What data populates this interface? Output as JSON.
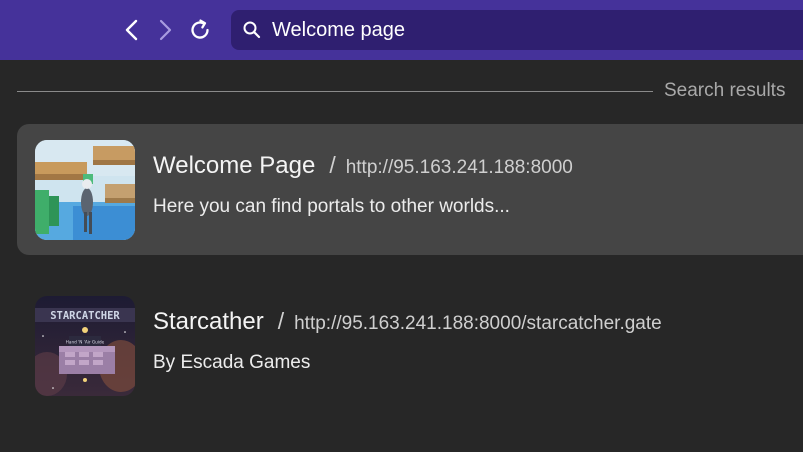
{
  "toolbar": {
    "back_icon": "chevron-left-icon",
    "forward_icon": "chevron-right-icon",
    "reload_icon": "reload-icon"
  },
  "search": {
    "icon": "search-icon",
    "value": "Welcome page"
  },
  "section": {
    "label": "Search results"
  },
  "results": [
    {
      "title": "Welcome Page",
      "separator": "/",
      "url": "http://95.163.241.188:8000",
      "description": "Here you can find portals to other worlds...",
      "selected": true
    },
    {
      "title": "Starcather",
      "separator": "/",
      "url": "http://95.163.241.188:8000/starcatcher.gate",
      "description": "By Escada Games",
      "selected": false
    }
  ],
  "thumbnails": {
    "starcatcher_logo_text": "STARCATCHER",
    "starcatcher_panel_text": "Hand 'N 'Air Guide"
  },
  "colors": {
    "topbar": "#45329a",
    "search_bg": "#2f1f70",
    "page_bg": "#272727",
    "selected_bg": "#454545"
  }
}
